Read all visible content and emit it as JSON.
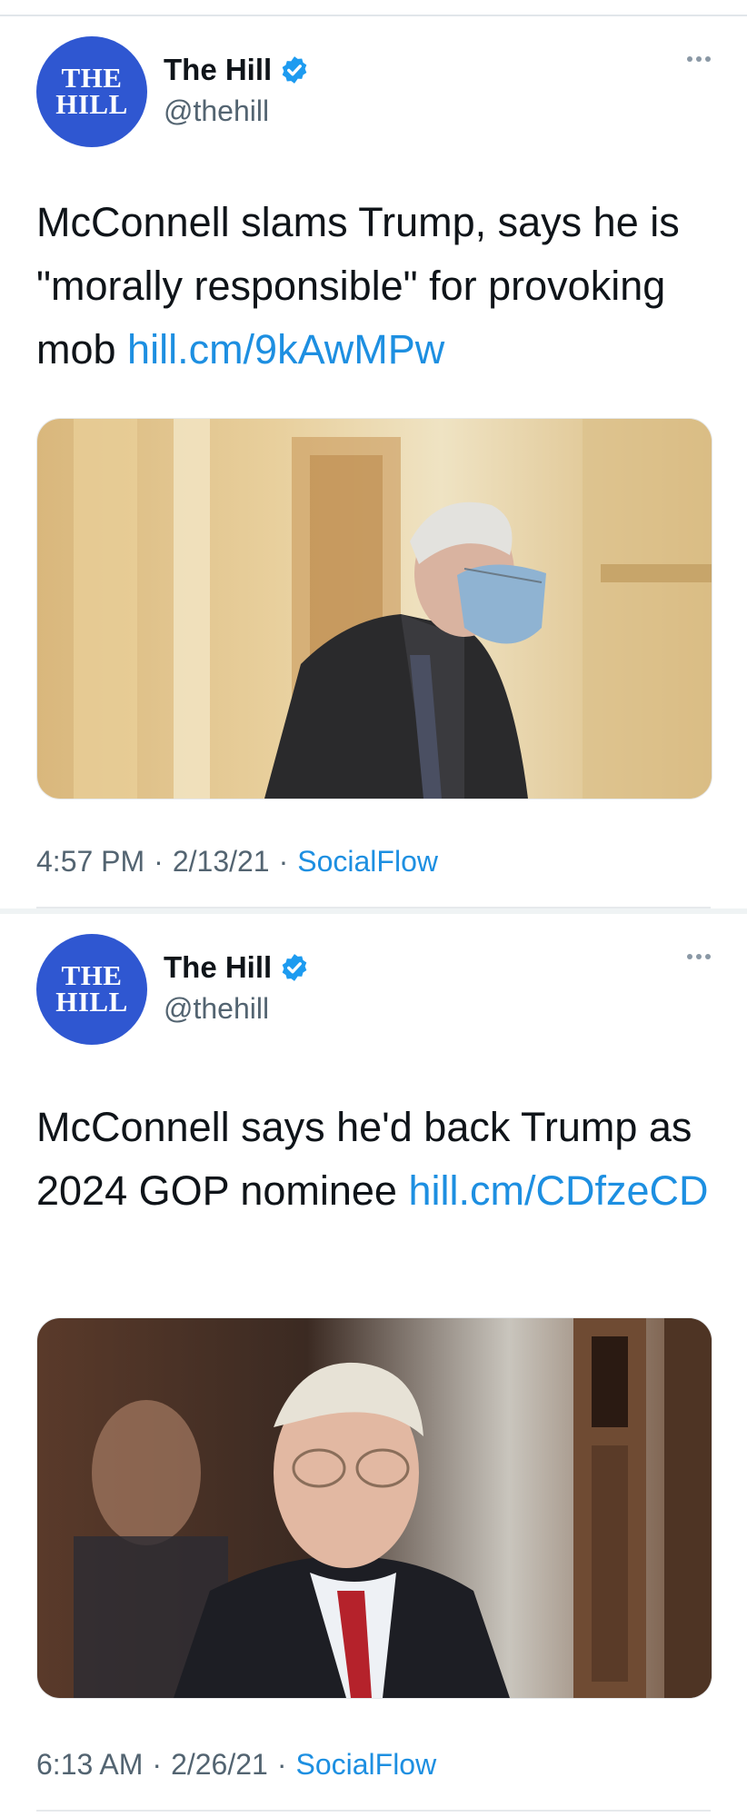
{
  "tweets": [
    {
      "avatar": {
        "line1": "THE",
        "line2": "HILL"
      },
      "name": "The Hill",
      "handle": "@thehill",
      "text": "McConnell slams Trump, says he is \"morally responsible\" for provoking mob ",
      "link": "hill.cm/9kAwMPw",
      "time": "4:57 PM",
      "date": "2/13/21",
      "source": "SocialFlow",
      "image": "photo-mask-mcconnell"
    },
    {
      "avatar": {
        "line1": "THE",
        "line2": "HILL"
      },
      "name": "The Hill",
      "handle": "@thehill",
      "text": "McConnell says he'd back Trump as 2024 GOP nominee ",
      "link": "hill.cm/CDfzeCD",
      "time": "6:13 AM",
      "date": "2/26/21",
      "source": "SocialFlow",
      "image": "photo-smiling-mcconnell"
    }
  ],
  "separator": "·",
  "icons": {
    "verified": "verified-badge-icon",
    "more": "more-options-icon"
  },
  "colors": {
    "link": "#1d8fe1",
    "avatar_bg": "#2f57d1",
    "verified": "#1d9bf0"
  }
}
